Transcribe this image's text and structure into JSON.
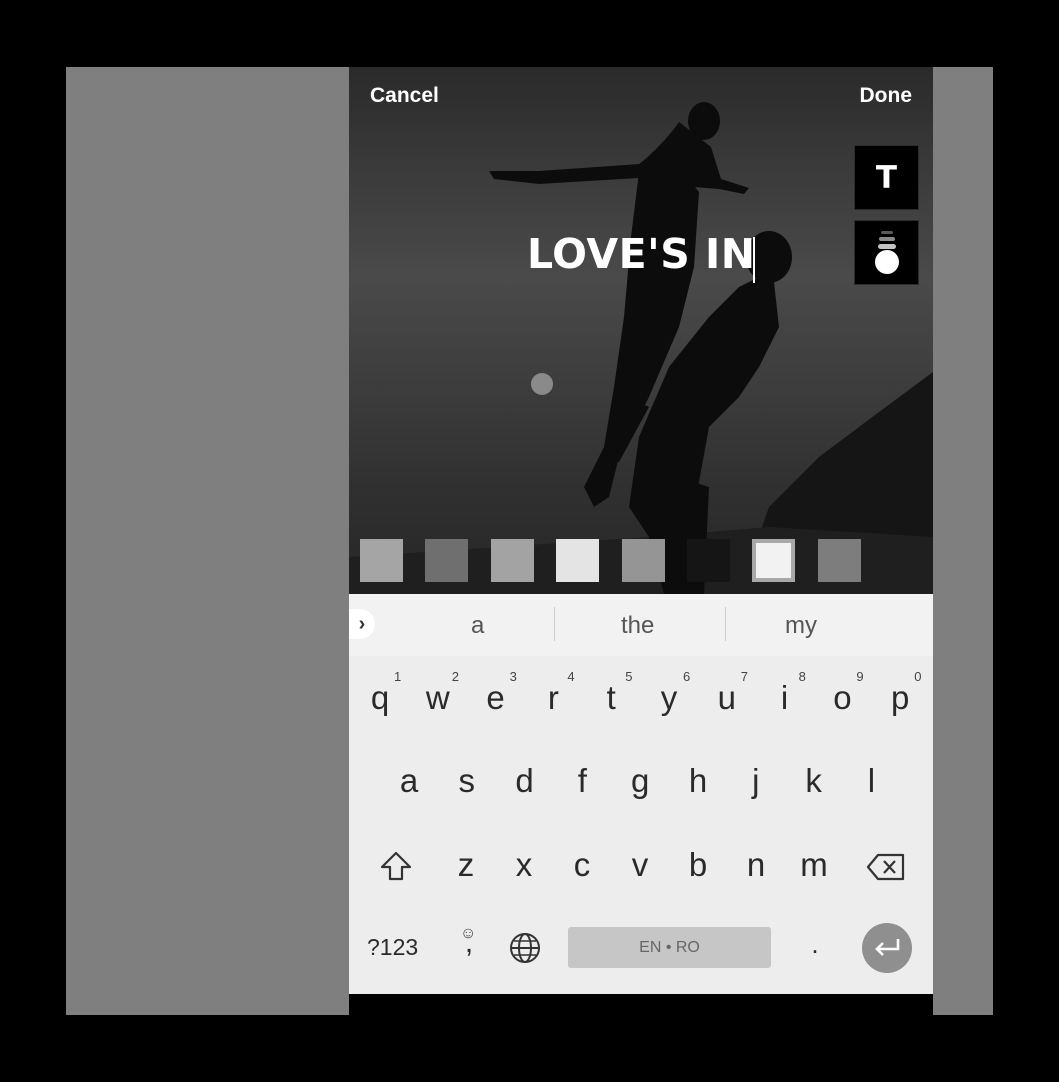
{
  "editor": {
    "cancel_label": "Cancel",
    "done_label": "Done",
    "text_tool_label": "T",
    "caption_text": "LOVE'S IN",
    "swatch_colors": [
      "#a5a5a5",
      "#6f6f6f",
      "#a3a3a3",
      "#e4e4e4",
      "#959595",
      "#151515",
      "#f2f2f2",
      "#7d7d7d"
    ],
    "selected_swatch_index": 6
  },
  "keyboard": {
    "suggestions": [
      "a",
      "the",
      "my"
    ],
    "row1": [
      "q",
      "w",
      "e",
      "r",
      "t",
      "y",
      "u",
      "i",
      "o",
      "p"
    ],
    "row1_hints": [
      "1",
      "2",
      "3",
      "4",
      "5",
      "6",
      "7",
      "8",
      "9",
      "0"
    ],
    "row2": [
      "a",
      "s",
      "d",
      "f",
      "g",
      "h",
      "j",
      "k",
      "l"
    ],
    "row3": [
      "z",
      "x",
      "c",
      "v",
      "b",
      "n",
      "m"
    ],
    "symbols_label": "?123",
    "emoji_hint": "☺",
    "comma_label": ",",
    "space_label": "EN • RO",
    "period_label": "."
  }
}
